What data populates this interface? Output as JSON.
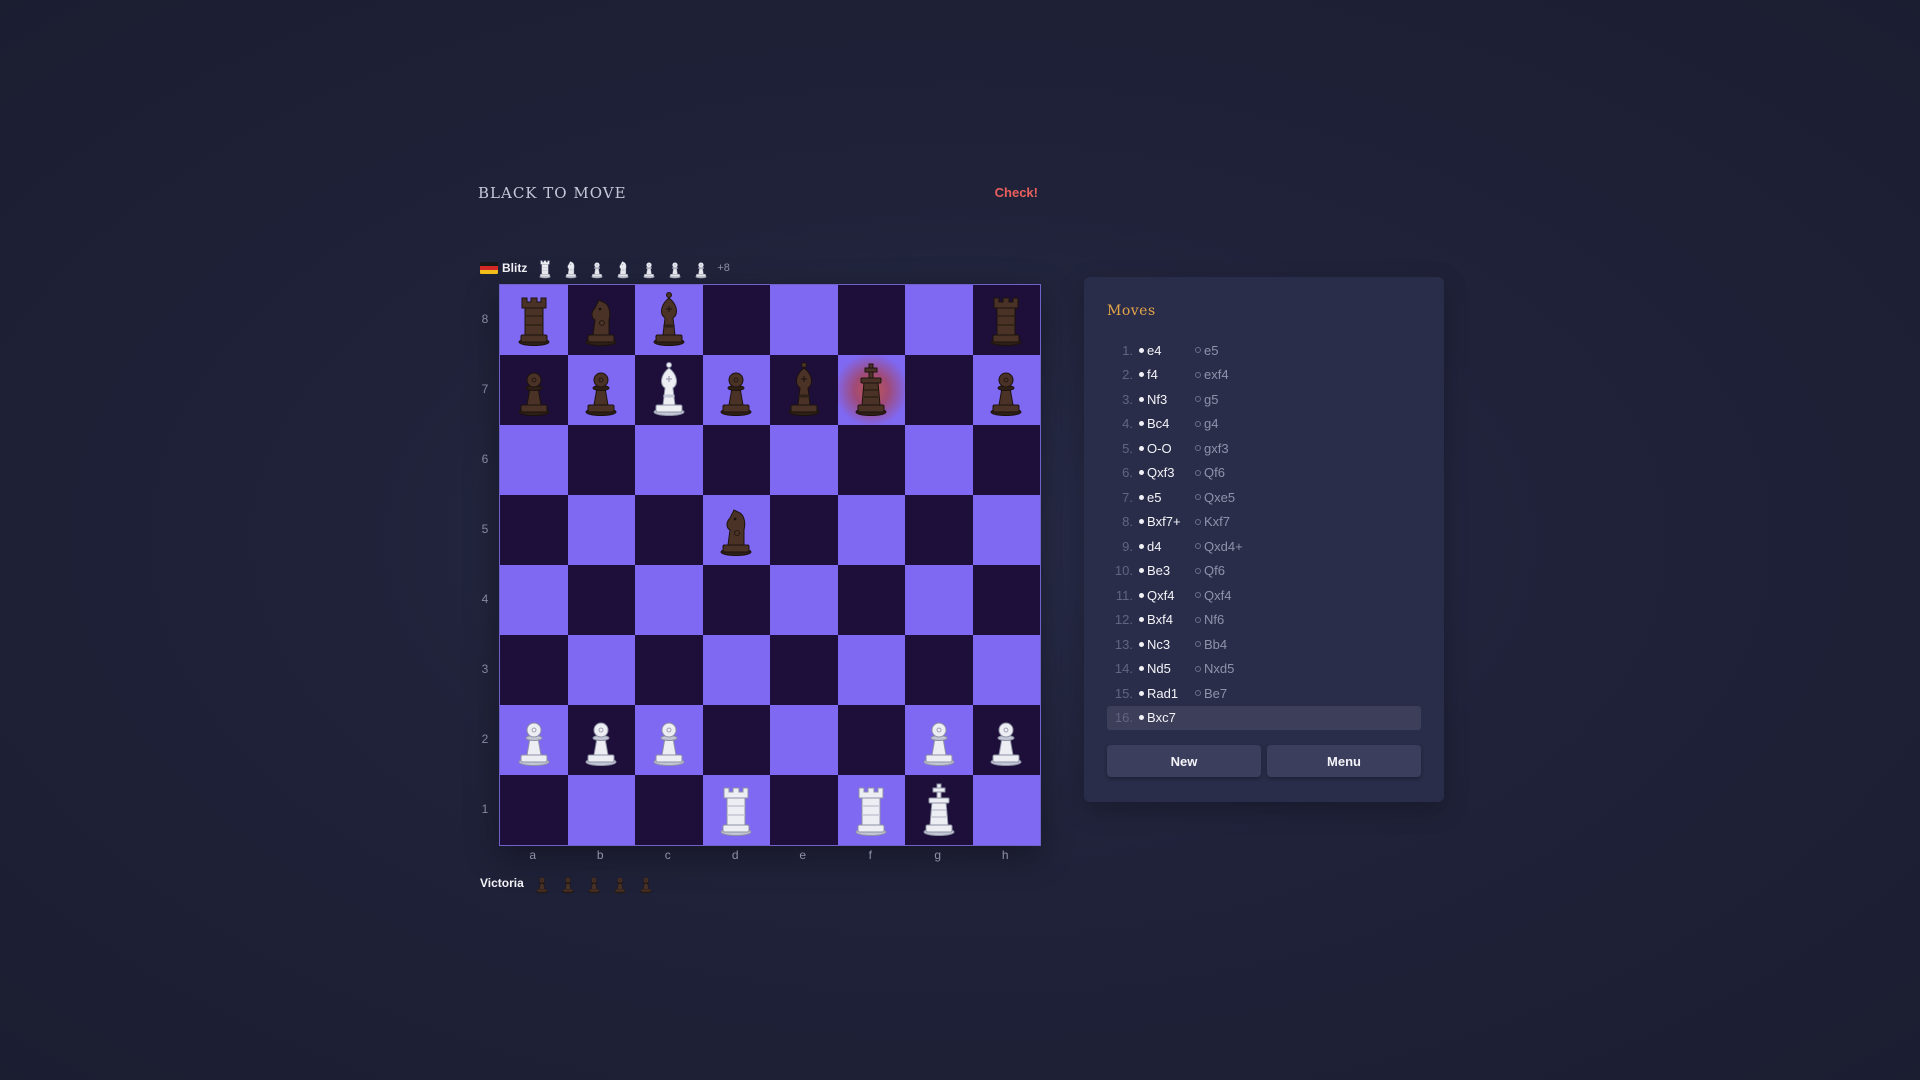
{
  "status": {
    "turn_text": "Black to move",
    "check_text": "Check!"
  },
  "players": {
    "top": {
      "name": "Blitz",
      "flag": "germany",
      "captured": [
        "rook",
        "knight",
        "pawn",
        "knight",
        "pawn",
        "pawn",
        "pawn"
      ],
      "captured_color": "white",
      "material": "+8"
    },
    "bottom": {
      "name": "Victoria",
      "captured": [
        "pawn",
        "pawn",
        "pawn",
        "pawn",
        "pawn"
      ],
      "captured_color": "black"
    }
  },
  "board": {
    "ranks": [
      "8",
      "7",
      "6",
      "5",
      "4",
      "3",
      "2",
      "1"
    ],
    "files": [
      "a",
      "b",
      "c",
      "d",
      "e",
      "f",
      "g",
      "h"
    ],
    "check_square": "f7",
    "colors": {
      "light": "#7f68f2",
      "dark": "#1e0f3a"
    },
    "pieces": [
      {
        "square": "a8",
        "type": "rook",
        "color": "black"
      },
      {
        "square": "b8",
        "type": "knight",
        "color": "black"
      },
      {
        "square": "c8",
        "type": "bishop",
        "color": "black"
      },
      {
        "square": "h8",
        "type": "rook",
        "color": "black"
      },
      {
        "square": "a7",
        "type": "pawn",
        "color": "black"
      },
      {
        "square": "b7",
        "type": "pawn",
        "color": "black"
      },
      {
        "square": "c7",
        "type": "bishop",
        "color": "white"
      },
      {
        "square": "d7",
        "type": "pawn",
        "color": "black"
      },
      {
        "square": "e7",
        "type": "bishop",
        "color": "black"
      },
      {
        "square": "f7",
        "type": "king",
        "color": "black"
      },
      {
        "square": "h7",
        "type": "pawn",
        "color": "black"
      },
      {
        "square": "d5",
        "type": "knight",
        "color": "black"
      },
      {
        "square": "a2",
        "type": "pawn",
        "color": "white"
      },
      {
        "square": "b2",
        "type": "pawn",
        "color": "white"
      },
      {
        "square": "c2",
        "type": "pawn",
        "color": "white"
      },
      {
        "square": "g2",
        "type": "pawn",
        "color": "white"
      },
      {
        "square": "h2",
        "type": "pawn",
        "color": "white"
      },
      {
        "square": "d1",
        "type": "rook",
        "color": "white"
      },
      {
        "square": "f1",
        "type": "rook",
        "color": "white"
      },
      {
        "square": "g1",
        "type": "king",
        "color": "white"
      }
    ]
  },
  "moves_panel": {
    "title": "Moves",
    "moves": [
      {
        "num": "1.",
        "white": "e4",
        "black": "e5"
      },
      {
        "num": "2.",
        "white": "f4",
        "black": "exf4"
      },
      {
        "num": "3.",
        "white": "Nf3",
        "black": "g5"
      },
      {
        "num": "4.",
        "white": "Bc4",
        "black": "g4"
      },
      {
        "num": "5.",
        "white": "O-O",
        "black": "gxf3"
      },
      {
        "num": "6.",
        "white": "Qxf3",
        "black": "Qf6"
      },
      {
        "num": "7.",
        "white": "e5",
        "black": "Qxe5"
      },
      {
        "num": "8.",
        "white": "Bxf7+",
        "black": "Kxf7"
      },
      {
        "num": "9.",
        "white": "d4",
        "black": "Qxd4+"
      },
      {
        "num": "10.",
        "white": "Be3",
        "black": "Qf6"
      },
      {
        "num": "11.",
        "white": "Qxf4",
        "black": "Qxf4"
      },
      {
        "num": "12.",
        "white": "Bxf4",
        "black": "Nf6"
      },
      {
        "num": "13.",
        "white": "Nc3",
        "black": "Bb4"
      },
      {
        "num": "14.",
        "white": "Nd5",
        "black": "Nxd5"
      },
      {
        "num": "15.",
        "white": "Rad1",
        "black": "Be7"
      },
      {
        "num": "16.",
        "white": "Bxc7",
        "black": ""
      }
    ],
    "current_move_index": 15,
    "buttons": {
      "new_label": "New",
      "menu_label": "Menu"
    }
  }
}
